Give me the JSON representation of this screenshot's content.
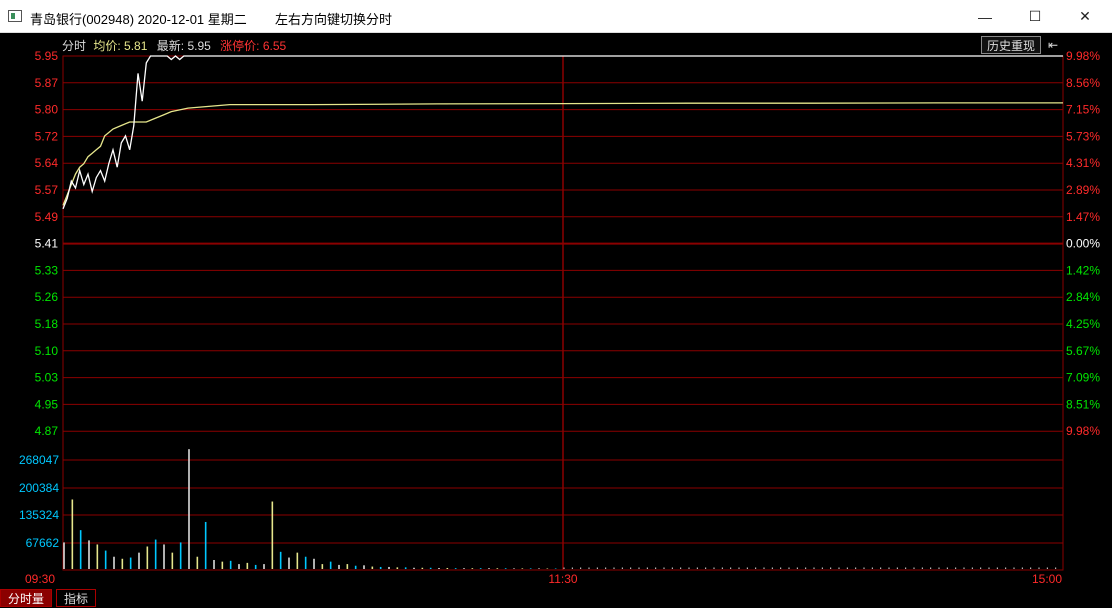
{
  "window": {
    "title": "青岛银行(002948) 2020-12-01 星期二",
    "hint": "左右方向键切换分时",
    "controls": {
      "minimize": "—",
      "maximize": "☐",
      "close": "✕"
    }
  },
  "header": {
    "label_fenshi": "分时",
    "label_avg": "均价:",
    "avg_value": "5.81",
    "label_last": "最新:",
    "last_value": "5.95",
    "label_limit": "涨停价:",
    "limit_value": "6.55",
    "history_button": "历史重现",
    "history_arrow": "⇤"
  },
  "tabs": {
    "volume": "分时量",
    "indicator": "指标"
  },
  "colors": {
    "grid": "#8b0000",
    "up": "#ff2a2a",
    "down": "#00e600",
    "price_line": "#ffffff",
    "avg_line": "#e6e68c",
    "volume_axis": "#00c8ff",
    "background": "#000000"
  },
  "chart_data": {
    "type": "line",
    "title": "",
    "price_axis": {
      "labels": [
        "5.95",
        "5.87",
        "5.80",
        "5.72",
        "5.64",
        "5.57",
        "5.49",
        "5.41",
        "5.33",
        "5.26",
        "5.18",
        "5.10",
        "5.03",
        "4.95",
        "4.87"
      ],
      "ylim": [
        4.87,
        5.95
      ],
      "base": 5.41
    },
    "percent_axis": [
      "9.98%",
      "8.56%",
      "7.15%",
      "5.73%",
      "4.31%",
      "2.89%",
      "1.47%",
      "0.00%",
      "1.42%",
      "2.84%",
      "4.25%",
      "5.67%",
      "7.09%",
      "8.51%",
      "9.98%"
    ],
    "volume_axis": [
      "268047",
      "200384",
      "135324",
      "67662"
    ],
    "volume_ylim": [
      0,
      335000
    ],
    "x_labels": [
      "09:30",
      "11:30",
      "15:00"
    ],
    "total_minutes": 240,
    "series": [
      {
        "points": [
          [
            0,
            5.52
          ],
          [
            1,
            5.55
          ],
          [
            2,
            5.58
          ],
          [
            3,
            5.61
          ],
          [
            4,
            5.63
          ],
          [
            5,
            5.64
          ],
          [
            6,
            5.66
          ],
          [
            7,
            5.67
          ],
          [
            8,
            5.68
          ],
          [
            9,
            5.69
          ],
          [
            10,
            5.72
          ],
          [
            12,
            5.74
          ],
          [
            14,
            5.75
          ],
          [
            16,
            5.76
          ],
          [
            18,
            5.76
          ],
          [
            20,
            5.76
          ],
          [
            22,
            5.77
          ],
          [
            24,
            5.78
          ],
          [
            26,
            5.79
          ],
          [
            30,
            5.8
          ],
          [
            35,
            5.805
          ],
          [
            40,
            5.81
          ],
          [
            60,
            5.81
          ],
          [
            90,
            5.812
          ],
          [
            120,
            5.813
          ],
          [
            150,
            5.814
          ],
          [
            180,
            5.814
          ],
          [
            210,
            5.815
          ],
          [
            240,
            5.815
          ]
        ]
      },
      {
        "points": [
          [
            0,
            5.51
          ],
          [
            1,
            5.54
          ],
          [
            2,
            5.59
          ],
          [
            3,
            5.57
          ],
          [
            4,
            5.62
          ],
          [
            5,
            5.58
          ],
          [
            6,
            5.61
          ],
          [
            7,
            5.56
          ],
          [
            8,
            5.6
          ],
          [
            9,
            5.62
          ],
          [
            10,
            5.59
          ],
          [
            11,
            5.64
          ],
          [
            12,
            5.68
          ],
          [
            13,
            5.63
          ],
          [
            14,
            5.7
          ],
          [
            15,
            5.72
          ],
          [
            16,
            5.68
          ],
          [
            17,
            5.75
          ],
          [
            18,
            5.9
          ],
          [
            19,
            5.82
          ],
          [
            20,
            5.93
          ],
          [
            21,
            5.95
          ],
          [
            25,
            5.95
          ],
          [
            26,
            5.94
          ],
          [
            27,
            5.95
          ],
          [
            28,
            5.94
          ],
          [
            29,
            5.95
          ],
          [
            240,
            5.95
          ]
        ]
      }
    ],
    "volume": [
      65000,
      170000,
      95000,
      70000,
      60000,
      45000,
      30000,
      25000,
      28000,
      40000,
      55000,
      72000,
      60000,
      40000,
      65000,
      293000,
      30000,
      115000,
      22000,
      18000,
      20000,
      12000,
      15000,
      10000,
      12000,
      165000,
      42000,
      28000,
      40000,
      30000,
      25000,
      12000,
      18000,
      10000,
      12000,
      8000,
      9000,
      6000,
      5000,
      5000,
      4000,
      4000,
      3000,
      3000,
      3000,
      2500,
      2500,
      2000,
      2000,
      2000,
      2000,
      2000,
      1800,
      1800,
      1500,
      1500,
      1500,
      1500,
      1200,
      1200
    ]
  }
}
